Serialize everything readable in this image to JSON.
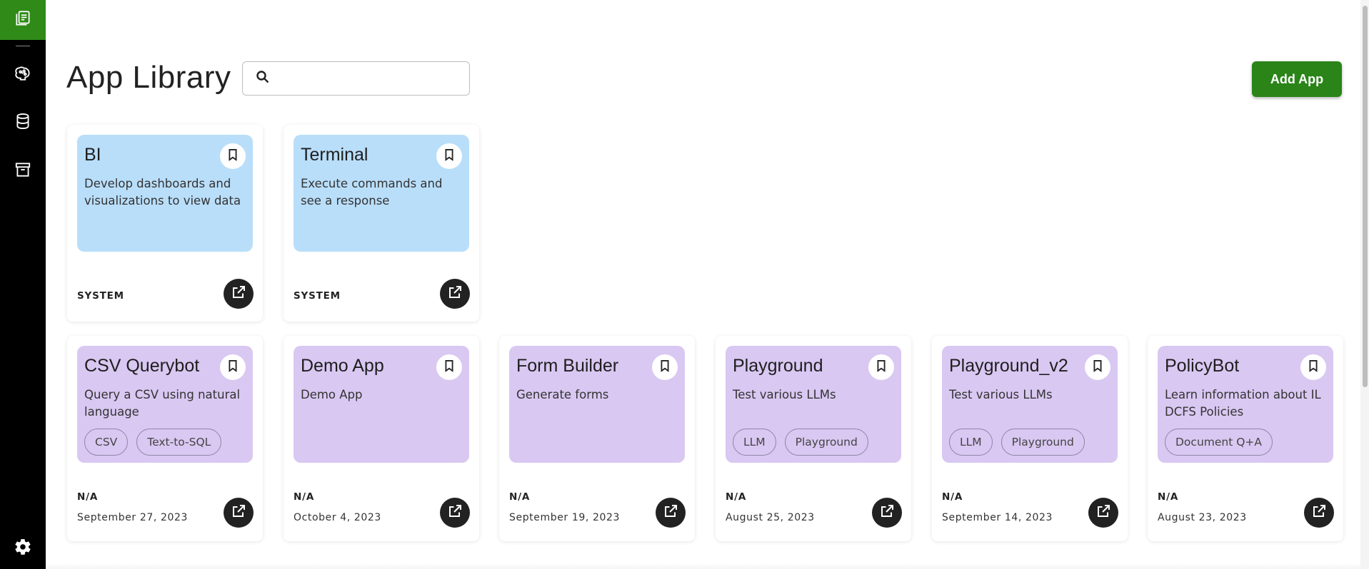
{
  "sidebar": {
    "items": [
      {
        "icon": "library-icon",
        "active": true
      },
      {
        "icon": "brain-icon"
      },
      {
        "icon": "database-icon"
      },
      {
        "icon": "archive-icon"
      },
      {
        "icon": "gear-icon"
      }
    ],
    "active_color": "#2f8a18"
  },
  "header": {
    "title": "App Library",
    "search_placeholder": "",
    "search_value": "",
    "add_label": "Add App",
    "add_color": "#2a8418"
  },
  "system_apps": [
    {
      "title": "BI",
      "description": "Develop dashboards and visualizations to view data",
      "owner": "SYSTEM"
    },
    {
      "title": "Terminal",
      "description": "Execute commands and see a response",
      "owner": "SYSTEM"
    }
  ],
  "user_apps": [
    {
      "title": "CSV Querybot",
      "description": "Query a CSV using natural language",
      "tags": [
        "CSV",
        "Text-to-SQL"
      ],
      "owner": "N/A",
      "date": "September 27, 2023"
    },
    {
      "title": "Demo App",
      "description": "Demo App",
      "tags": [],
      "owner": "N/A",
      "date": "October 4, 2023"
    },
    {
      "title": "Form Builder",
      "description": "Generate forms",
      "tags": [],
      "owner": "N/A",
      "date": "September 19, 2023"
    },
    {
      "title": "Playground",
      "description": "Test various LLMs",
      "tags": [
        "LLM",
        "Playground"
      ],
      "owner": "N/A",
      "date": "August 25, 2023"
    },
    {
      "title": "Playground_v2",
      "description": "Test various LLMs",
      "tags": [
        "LLM",
        "Playground"
      ],
      "owner": "N/A",
      "date": "September 14, 2023"
    },
    {
      "title": "PolicyBot",
      "description": "Learn information about IL DCFS Policies",
      "tags": [
        "Document Q+A"
      ],
      "owner": "N/A",
      "date": "August 23, 2023"
    }
  ],
  "colors": {
    "system_card": "#b9defa",
    "user_card": "#d9c8f2"
  }
}
